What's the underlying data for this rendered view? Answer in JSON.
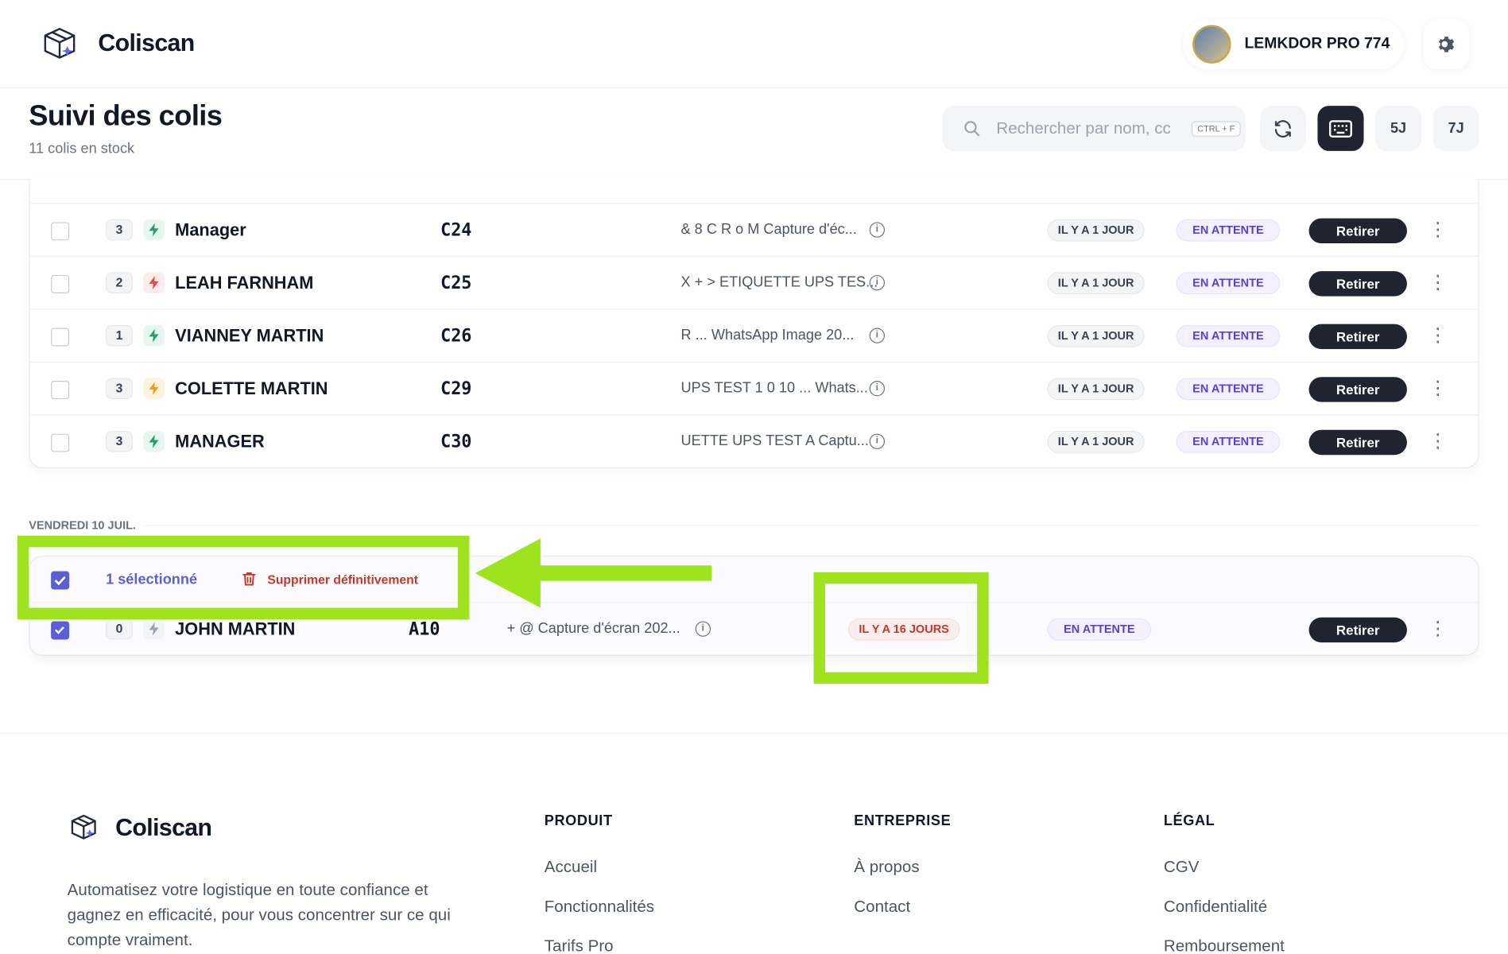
{
  "app": {
    "name": "Coliscan"
  },
  "user": {
    "name": "LEMKDOR PRO 774"
  },
  "page": {
    "title": "Suivi des colis",
    "subtitle": "11 colis en stock"
  },
  "search": {
    "placeholder": "Rechercher par nom, cc",
    "shortcut": "CTRL + F"
  },
  "toolbar": {
    "btn_5j": "5J",
    "btn_7j": "7J"
  },
  "rows": [
    {
      "count": "3",
      "bolt_color": "#22a06b",
      "bolt_bg": "#e7f6ee",
      "name": "Manager",
      "code": "C24",
      "note": "& 8 C R o M Capture d'éc...",
      "age": "IL Y A 1 JOUR",
      "status": "EN ATTENTE",
      "action": "Retirer"
    },
    {
      "count": "2",
      "bolt_color": "#e5484d",
      "bolt_bg": "#fdecec",
      "name": "LEAH FARNHAM",
      "code": "C25",
      "note": "X + > ETIQUETTE UPS TES...",
      "age": "IL Y A 1 JOUR",
      "status": "EN ATTENTE",
      "action": "Retirer"
    },
    {
      "count": "1",
      "bolt_color": "#22a06b",
      "bolt_bg": "#e7f6ee",
      "name": "VIANNEY MARTIN",
      "code": "C26",
      "note": "R ... WhatsApp Image 20...",
      "age": "IL Y A 1 JOUR",
      "status": "EN ATTENTE",
      "action": "Retirer"
    },
    {
      "count": "3",
      "bolt_color": "#f59e0b",
      "bolt_bg": "#fdf3e1",
      "name": "COLETTE MARTIN",
      "code": "C29",
      "note": "UPS TEST 1 0 10 ... Whats...",
      "age": "IL Y A 1 JOUR",
      "status": "EN ATTENTE",
      "action": "Retirer"
    },
    {
      "count": "3",
      "bolt_color": "#22a06b",
      "bolt_bg": "#e7f6ee",
      "name": "MANAGER",
      "code": "C30",
      "note": "UETTE UPS TEST A Captu...",
      "age": "IL Y A 1 JOUR",
      "status": "EN ATTENTE",
      "action": "Retirer"
    }
  ],
  "group2": {
    "date_label": "VENDREDI 10 JUIL.",
    "selection_text": "1 sélectionné",
    "delete_text": "Supprimer définitivement",
    "row": {
      "count": "0",
      "name": "JOHN MARTIN",
      "code": "A10",
      "note": "+ @ Capture d'écran 202...",
      "age": "IL Y A 16 JOURS",
      "status": "EN ATTENTE",
      "action": "Retirer"
    }
  },
  "footer": {
    "description": "Automatisez votre logistique en toute confiance et gagnez en efficacité, pour vous concentrer sur ce qui compte vraiment.",
    "produit": {
      "title": "PRODUIT",
      "links": [
        "Accueil",
        "Fonctionnalités",
        "Tarifs Pro"
      ]
    },
    "entreprise": {
      "title": "ENTREPRISE",
      "links": [
        "À propos",
        "Contact"
      ]
    },
    "legal": {
      "title": "LÉGAL",
      "links": [
        "CGV",
        "Confidentialité",
        "Remboursement"
      ]
    }
  },
  "colors": {
    "accent": "#5b5fd6",
    "highlight": "#9fe31e",
    "dark": "#1f2430",
    "danger": "#c0392b"
  }
}
